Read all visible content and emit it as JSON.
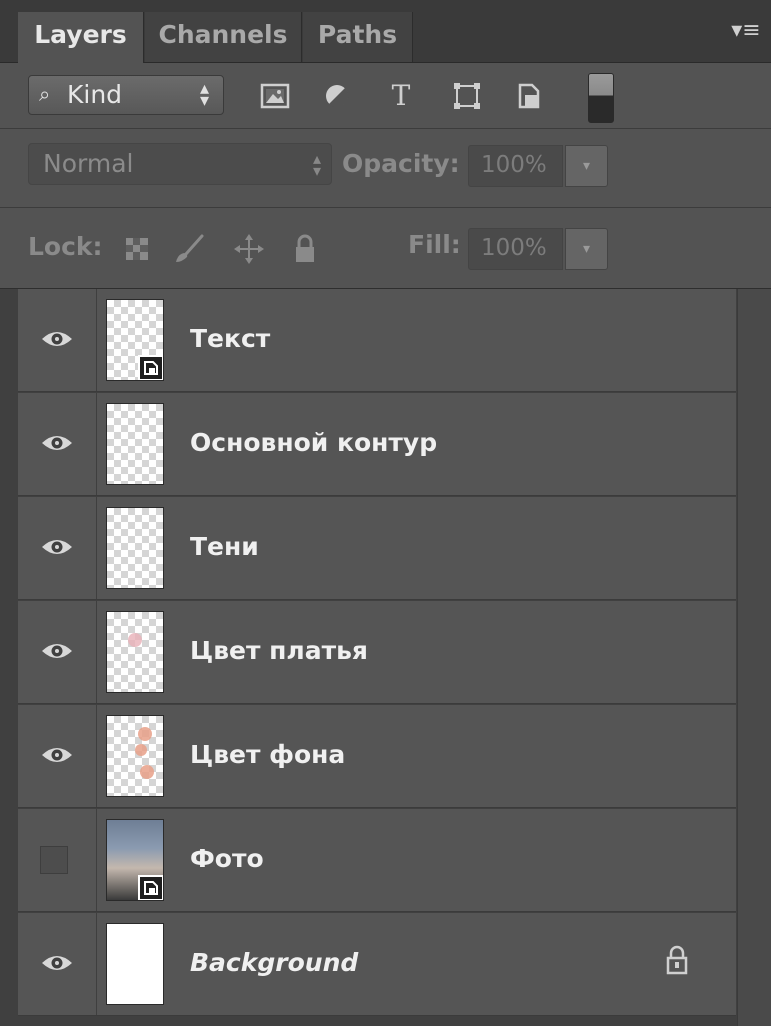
{
  "tabs": {
    "layers": "Layers",
    "channels": "Channels",
    "paths": "Paths"
  },
  "filter": {
    "kind_label": "Kind",
    "search_icon": "search-icon",
    "type_glyph": "T"
  },
  "blend": {
    "mode": "Normal",
    "opacity_label": "Opacity:",
    "opacity_value": "100%"
  },
  "lock": {
    "label": "Lock:",
    "fill_label": "Fill:",
    "fill_value": "100%"
  },
  "layers": [
    {
      "name": "Текст",
      "visible": true,
      "thumb": "smart-object-checker"
    },
    {
      "name": "Основной контур",
      "visible": true,
      "thumb": "checker"
    },
    {
      "name": "Тени",
      "visible": true,
      "thumb": "checker"
    },
    {
      "name": "Цвет платья",
      "visible": true,
      "thumb": "checker"
    },
    {
      "name": "Цвет фона",
      "visible": true,
      "thumb": "checker"
    },
    {
      "name": "Фото",
      "visible": false,
      "thumb": "smart-object-photo"
    },
    {
      "name": "Background",
      "visible": true,
      "thumb": "white",
      "locked": true
    }
  ],
  "colors": {
    "panel_bg": "#535353",
    "tab_bar": "#3a3a3a",
    "row_bg": "#555555",
    "text": "#f0f0f0"
  }
}
